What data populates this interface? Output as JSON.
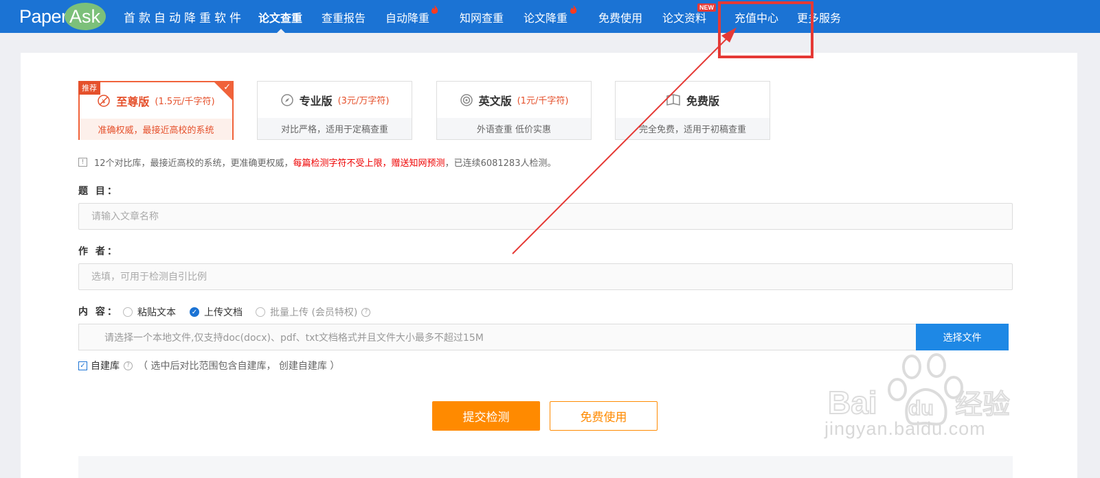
{
  "brand": {
    "logo_left": "Paper",
    "logo_right": "Ask",
    "tagline": "首款自动降重软件"
  },
  "nav": {
    "items": [
      {
        "label": "论文查重",
        "active": true
      },
      {
        "label": "查重报告"
      },
      {
        "label": "自动降重",
        "hot": true
      },
      {
        "label": "知网查重"
      },
      {
        "label": "论文降重",
        "hot": true
      },
      {
        "label": "免费使用"
      },
      {
        "label": "论文资料",
        "badge": "NEW"
      },
      {
        "label": "充值中心"
      },
      {
        "label": "更多服务"
      }
    ]
  },
  "plans": [
    {
      "badge": "推荐",
      "name": "至尊版",
      "price": "(1.5元/千字符)",
      "desc": "准确权威，最接近高校的系统",
      "selected": true,
      "icon": "ban-icon"
    },
    {
      "name": "专业版",
      "price": "(3元/万字符)",
      "desc": "对比严格，适用于定稿查重",
      "icon": "compass-icon"
    },
    {
      "name": "英文版",
      "price": "(1元/千字符)",
      "desc": "外语查重 低价实惠",
      "icon": "target-icon"
    },
    {
      "name": "免费版",
      "price": "",
      "desc": "完全免费，适用于初稿查重",
      "icon": "book-icon"
    }
  ],
  "info": {
    "prefix": "12个对比库，最接近高校的系统，更准确更权威，",
    "highlight": "每篇检测字符不受上限，赠送知网预测",
    "suffix": "，已连续6081283人检测。"
  },
  "form": {
    "title_label": "题 目：",
    "title_placeholder": "请输入文章名称",
    "author_label": "作 者：",
    "author_placeholder": "选填，可用于检测自引比例",
    "content_label": "内 容：",
    "content_options": [
      {
        "label": "粘贴文本",
        "checked": false
      },
      {
        "label": "上传文档",
        "checked": true
      },
      {
        "label": "批量上传 (会员特权)",
        "disabled": true
      }
    ],
    "file_placeholder": "请选择一个本地文件,仅支持doc(docx)、pdf、txt文档格式并且文件大小最多不超过15M",
    "file_button": "选择文件",
    "self_lib_label": "自建库",
    "self_lib_note": "（ 选中后对比范围包含自建库， 创建自建库 ）",
    "self_lib_checked": true
  },
  "actions": {
    "submit": "提交检测",
    "free": "免费使用"
  },
  "watermark": {
    "text": "jingyan.baidu.com",
    "brand": "Baidu 经验"
  },
  "colors": {
    "nav_bg": "#1b73d4",
    "accent_orange": "#ff8a00",
    "plan_selected": "#e5502b",
    "annotation_red": "#e53935"
  }
}
